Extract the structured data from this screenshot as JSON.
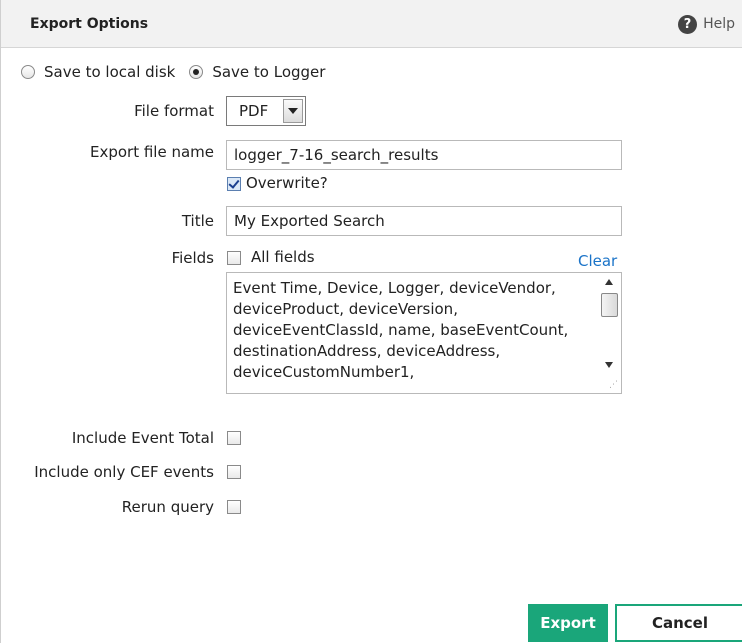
{
  "header": {
    "title": "Export Options",
    "help_label": "Help",
    "help_icon": "question-circle-icon"
  },
  "destination": {
    "options": [
      {
        "label": "Save to local disk",
        "checked": false
      },
      {
        "label": "Save to Logger",
        "checked": true
      }
    ]
  },
  "form": {
    "file_format": {
      "label": "File format",
      "value": "PDF"
    },
    "export_file_name": {
      "label": "Export file name",
      "value": "logger_7-16_search_results"
    },
    "overwrite": {
      "label": "Overwrite?",
      "checked": true
    },
    "title": {
      "label": "Title",
      "value": "My Exported Search"
    },
    "fields": {
      "label": "Fields",
      "all_fields_label": "All fields",
      "all_fields_checked": false,
      "clear_label": "Clear",
      "lines": [
        "Event Time, Device, Logger, deviceVendor,",
        "deviceProduct, deviceVersion,",
        "deviceEventClassId, name, baseEventCount,",
        "destinationAddress, deviceAddress,",
        "deviceCustomNumber1,"
      ]
    },
    "include_event_total": {
      "label": "Include Event Total",
      "checked": false
    },
    "include_only_cef": {
      "label": "Include only CEF events",
      "checked": false
    },
    "rerun_query": {
      "label": "Rerun query",
      "checked": false
    }
  },
  "buttons": {
    "export": "Export",
    "cancel": "Cancel"
  },
  "colors": {
    "accent": "#1aa67a",
    "link": "#1a73c8",
    "header_bg": "#f2f2f2"
  }
}
